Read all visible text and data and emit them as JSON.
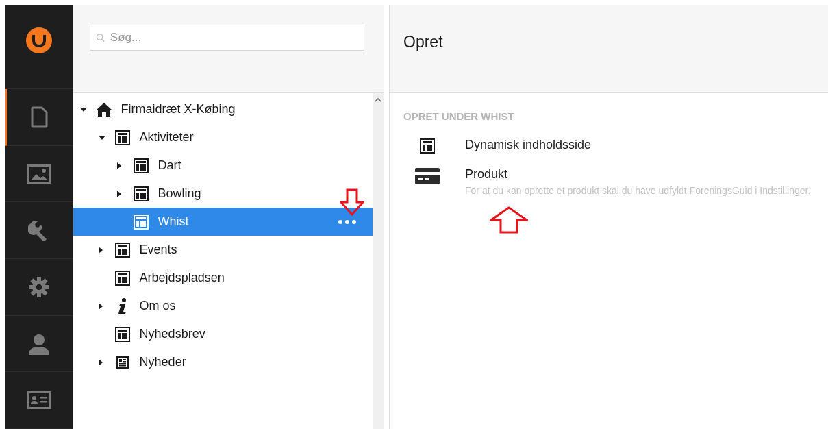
{
  "rail": [
    {
      "kind": "logo"
    },
    {
      "kind": "content",
      "selected": true
    },
    {
      "kind": "media",
      "selected": false
    },
    {
      "kind": "settings",
      "selected": false
    },
    {
      "kind": "gear",
      "selected": false
    },
    {
      "kind": "user",
      "selected": false
    },
    {
      "kind": "members",
      "selected": false
    }
  ],
  "search": {
    "placeholder": "Søg..."
  },
  "tree": [
    {
      "label": "Firmaidræt X-Købing",
      "kind": "home",
      "expandable": true,
      "expanded": true,
      "selected": false,
      "children": [
        {
          "label": "Aktiviteter",
          "kind": "page",
          "expandable": true,
          "expanded": true,
          "selected": false,
          "children": [
            {
              "label": "Dart",
              "kind": "page",
              "expandable": true,
              "expanded": false,
              "selected": false
            },
            {
              "label": "Bowling",
              "kind": "page",
              "expandable": true,
              "expanded": false,
              "selected": false
            },
            {
              "label": "Whist",
              "kind": "page",
              "expandable": false,
              "expanded": false,
              "selected": true
            }
          ]
        },
        {
          "label": "Events",
          "kind": "page",
          "expandable": true,
          "expanded": false,
          "selected": false
        },
        {
          "label": "Arbejdspladsen",
          "kind": "page",
          "expandable": false,
          "expanded": false,
          "selected": false
        },
        {
          "label": "Om os",
          "kind": "info",
          "expandable": true,
          "expanded": false,
          "selected": false
        },
        {
          "label": "Nyhedsbrev",
          "kind": "page",
          "expandable": false,
          "expanded": false,
          "selected": false
        },
        {
          "label": "Nyheder",
          "kind": "news",
          "expandable": true,
          "expanded": false,
          "selected": false
        }
      ]
    }
  ],
  "panel": {
    "title": "Opret",
    "section": "OPRET UNDER WHIST",
    "options": [
      {
        "kind": "page",
        "name": "Dynamisk indholdsside"
      },
      {
        "kind": "product",
        "name": "Produkt",
        "description": "For at du kan oprette et produkt skal du have udfyldt ForeningsGuid i Indstillinger."
      }
    ]
  }
}
